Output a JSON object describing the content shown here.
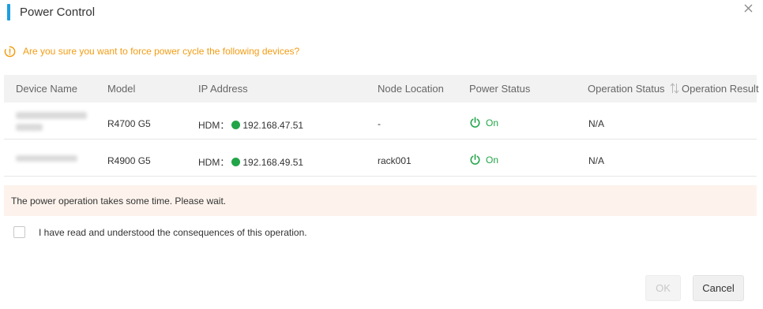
{
  "dialog": {
    "title": "Power Control",
    "close_icon": "close-icon"
  },
  "warning": {
    "icon": "warning-circle-icon",
    "text": "Are you sure you want to force power cycle the following devices?",
    "color": "#f39c12"
  },
  "table": {
    "columns": {
      "device_name": "Device Name",
      "model": "Model",
      "ip_address": "IP Address",
      "node_location": "Node Location",
      "power_status": "Power Status",
      "operation_status": "Operation Status",
      "operation_result": "Operation Result"
    },
    "rows": [
      {
        "model": "R4700 G5",
        "ip_label": "HDM：",
        "ip": "192.168.47.51",
        "node_location": "-",
        "power_status": "On",
        "operation_status": "N/A"
      },
      {
        "model": "R4900 G5",
        "ip_label": "HDM：",
        "ip": "192.168.49.51",
        "node_location": "rack001",
        "power_status": "On",
        "operation_status": "N/A"
      }
    ]
  },
  "notice": {
    "text": "The power operation takes some time. Please wait."
  },
  "confirm": {
    "checked": false,
    "label": "I have read and understood the consequences of this operation."
  },
  "buttons": {
    "ok": "OK",
    "cancel": "Cancel"
  },
  "colors": {
    "accent": "#1d9ee0",
    "status_on": "#22a548",
    "notice_bg": "#fdf3ec"
  }
}
